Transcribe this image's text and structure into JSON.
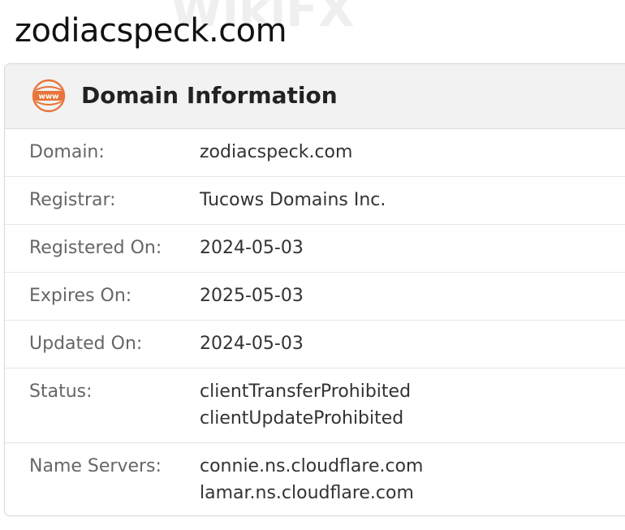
{
  "page": {
    "domain_heading": "zodiacspeck.com"
  },
  "card": {
    "icon": "www-globe-icon",
    "title": "Domain Information"
  },
  "rows": {
    "domain": {
      "label": "Domain:",
      "value": "zodiacspeck.com"
    },
    "registrar": {
      "label": "Registrar:",
      "value": "Tucows Domains Inc."
    },
    "registered_on": {
      "label": "Registered On:",
      "value": "2024-05-03"
    },
    "expires_on": {
      "label": "Expires On:",
      "value": "2025-05-03"
    },
    "updated_on": {
      "label": "Updated On:",
      "value": "2024-05-03"
    },
    "status": {
      "label": "Status:",
      "values": [
        "clientTransferProhibited",
        "clientUpdateProhibited"
      ]
    },
    "name_servers": {
      "label": "Name Servers:",
      "values": [
        "connie.ns.cloudflare.com",
        "lamar.ns.cloudflare.com"
      ]
    }
  },
  "watermark": {
    "text": "WikiFX"
  },
  "colors": {
    "accent_orange": "#e8743b",
    "header_bg": "#f2f2f2",
    "label_gray": "#666666",
    "value_dark": "#333333"
  }
}
